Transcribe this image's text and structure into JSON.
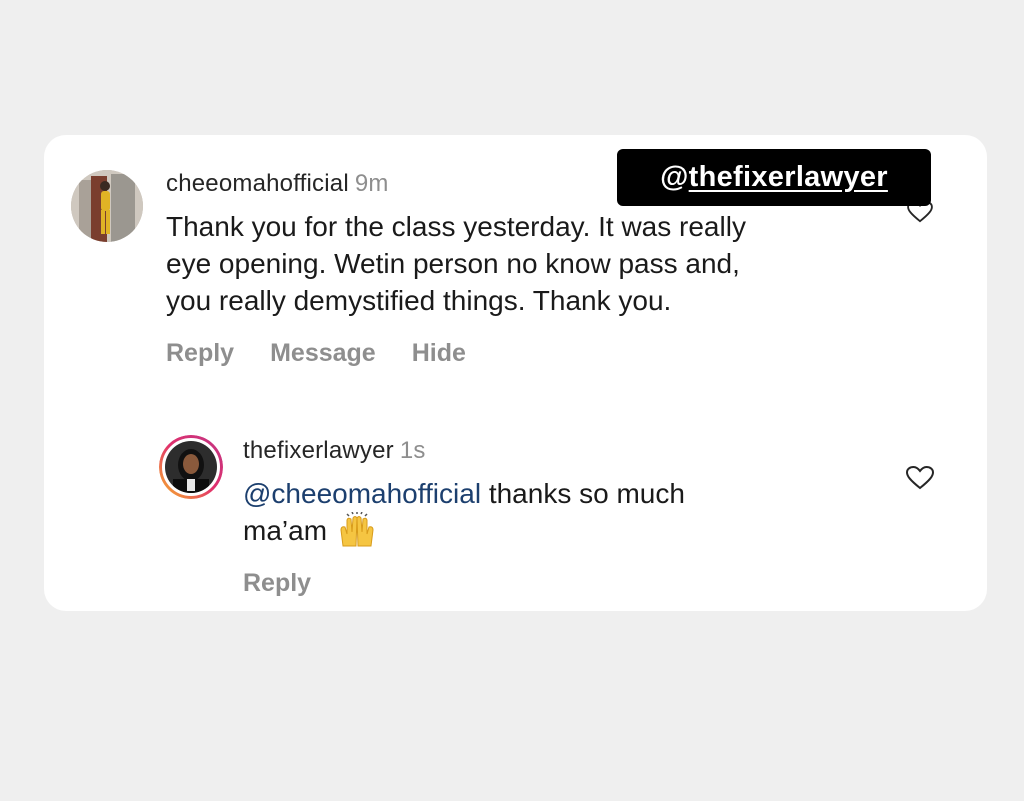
{
  "comment": {
    "username": "cheeomahofficial",
    "time": "9m",
    "text_lines": [
      "Thank you for the class yesterday. It was really",
      "eye opening. Wetin person no know pass and,",
      "you really demystified things. Thank you."
    ],
    "actions": [
      "Reply",
      "Message",
      "Hide"
    ]
  },
  "reply": {
    "username": "thefixerlawyer",
    "time": "1s",
    "mention": "@cheeomahofficial",
    "text_after_mention": " thanks so much",
    "text_line2": "ma’am",
    "emoji": "raising-hands-emoji",
    "action": "Reply"
  },
  "tag": {
    "at": "@",
    "handle": "thefixerlawyer"
  },
  "colors": {
    "background": "#efefef",
    "card": "#ffffff",
    "mention": "#1c3f6e",
    "muted": "#8e8e8e",
    "tag_bg": "#000000"
  },
  "icons": {
    "like": "heart-outline-icon",
    "ring": "story-ring"
  }
}
